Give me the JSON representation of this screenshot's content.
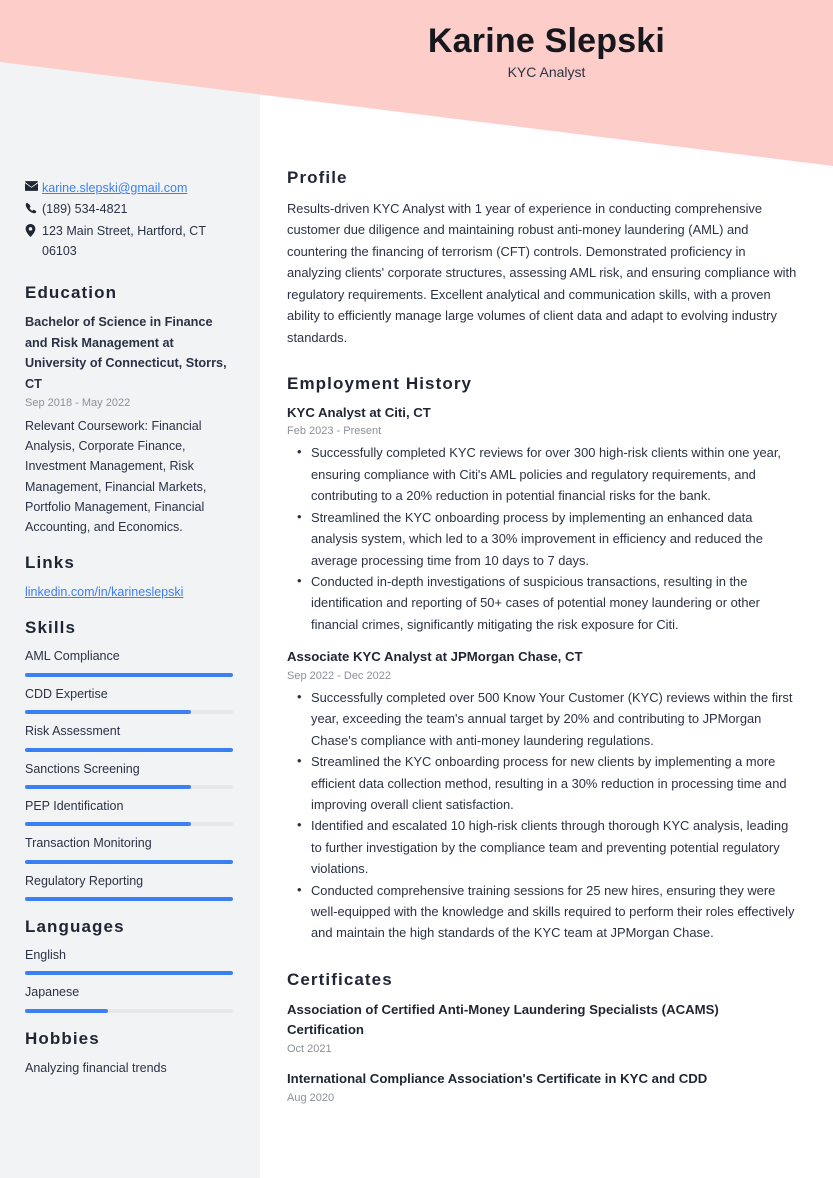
{
  "header": {
    "name": "Karine Slepski",
    "job_title": "KYC Analyst",
    "band_color": "#fdcdc9"
  },
  "theme": {
    "accent": "#3b7ff5",
    "sidebar_bg": "#f1f3f5",
    "text": "#2b3245",
    "muted": "#8b9099"
  },
  "sidebar": {
    "contact": [
      {
        "icon": "envelope-icon",
        "text": "karine.slepski@gmail.com",
        "is_link": true
      },
      {
        "icon": "phone-icon",
        "text": "(189) 534-4821",
        "is_link": false
      },
      {
        "icon": "location-pin-icon",
        "text": "123 Main Street, Hartford, CT 06103",
        "is_link": false
      }
    ],
    "education": {
      "heading": "Education",
      "degree": "Bachelor of Science in Finance and Risk Management at University of Connecticut, Storrs, CT",
      "date": "Sep 2018 - May 2022",
      "description": "Relevant Coursework: Financial Analysis, Corporate Finance, Investment Management, Risk Management, Financial Markets, Portfolio Management, Financial Accounting, and Economics."
    },
    "links": {
      "heading": "Links",
      "items": [
        {
          "label": "linkedin.com/in/karineslepski"
        }
      ]
    },
    "skills": {
      "heading": "Skills",
      "items": [
        {
          "label": "AML Compliance",
          "level": 100
        },
        {
          "label": "CDD Expertise",
          "level": 80
        },
        {
          "label": "Risk Assessment",
          "level": 100
        },
        {
          "label": "Sanctions Screening",
          "level": 80
        },
        {
          "label": "PEP Identification",
          "level": 80
        },
        {
          "label": "Transaction Monitoring",
          "level": 100
        },
        {
          "label": "Regulatory Reporting",
          "level": 100
        }
      ]
    },
    "languages": {
      "heading": "Languages",
      "items": [
        {
          "label": "English",
          "level": 100
        },
        {
          "label": "Japanese",
          "level": 40
        }
      ]
    },
    "hobbies": {
      "heading": "Hobbies",
      "items": [
        {
          "label": "Analyzing financial trends"
        }
      ]
    }
  },
  "main": {
    "profile": {
      "heading": "Profile",
      "text": "Results-driven KYC Analyst with 1 year of experience in conducting comprehensive customer due diligence and maintaining robust anti-money laundering (AML) and countering the financing of terrorism (CFT) controls. Demonstrated proficiency in analyzing clients' corporate structures, assessing AML risk, and ensuring compliance with regulatory requirements. Excellent analytical and communication skills, with a proven ability to efficiently manage large volumes of client data and adapt to evolving industry standards."
    },
    "employment": {
      "heading": "Employment History",
      "jobs": [
        {
          "title": "KYC Analyst at Citi, CT",
          "date": "Feb 2023 - Present",
          "bullets": [
            "Successfully completed KYC reviews for over 300 high-risk clients within one year, ensuring compliance with Citi's AML policies and regulatory requirements, and contributing to a 20% reduction in potential financial risks for the bank.",
            "Streamlined the KYC onboarding process by implementing an enhanced data analysis system, which led to a 30% improvement in efficiency and reduced the average processing time from 10 days to 7 days.",
            "Conducted in-depth investigations of suspicious transactions, resulting in the identification and reporting of 50+ cases of potential money laundering or other financial crimes, significantly mitigating the risk exposure for Citi."
          ]
        },
        {
          "title": "Associate KYC Analyst at JPMorgan Chase, CT",
          "date": "Sep 2022 - Dec 2022",
          "bullets": [
            "Successfully completed over 500 Know Your Customer (KYC) reviews within the first year, exceeding the team's annual target by 20% and contributing to JPMorgan Chase's compliance with anti-money laundering regulations.",
            "Streamlined the KYC onboarding process for new clients by implementing a more efficient data collection method, resulting in a 30% reduction in processing time and improving overall client satisfaction.",
            "Identified and escalated 10 high-risk clients through thorough KYC analysis, leading to further investigation by the compliance team and preventing potential regulatory violations.",
            "Conducted comprehensive training sessions for 25 new hires, ensuring they were well-equipped with the knowledge and skills required to perform their roles effectively and maintain the high standards of the KYC team at JPMorgan Chase."
          ]
        }
      ]
    },
    "certificates": {
      "heading": "Certificates",
      "items": [
        {
          "title": "Association of Certified Anti-Money Laundering Specialists (ACAMS) Certification",
          "date": "Oct 2021"
        },
        {
          "title": "International Compliance Association's Certificate in KYC and CDD",
          "date": "Aug 2020"
        }
      ]
    }
  }
}
